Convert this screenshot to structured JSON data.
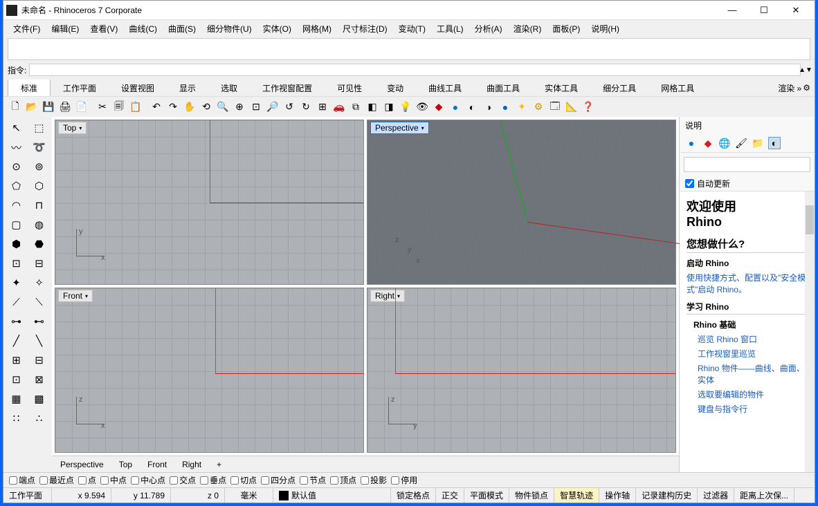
{
  "title": "未命名 - Rhinoceros 7 Corporate",
  "menus": [
    "文件(F)",
    "编辑(E)",
    "查看(V)",
    "曲线(C)",
    "曲面(S)",
    "细分物件(U)",
    "实体(O)",
    "网格(M)",
    "尺寸标注(D)",
    "变动(T)",
    "工具(L)",
    "分析(A)",
    "渲染(R)",
    "面板(P)",
    "说明(H)"
  ],
  "cmd_label": "指令:",
  "tabs": [
    "标准",
    "工作平面",
    "设置视图",
    "显示",
    "选取",
    "工作视窗配置",
    "可见性",
    "变动",
    "曲线工具",
    "曲面工具",
    "实体工具",
    "细分工具",
    "网格工具"
  ],
  "tabs_tail": "渲染 »",
  "active_tab": 0,
  "viewports": {
    "top": "Top",
    "perspective": "Perspective",
    "front": "Front",
    "right": "Right"
  },
  "active_viewport": "Perspective",
  "viewtabs": [
    "Perspective",
    "Top",
    "Front",
    "Right",
    "+"
  ],
  "help": {
    "title": "说明",
    "auto_update": "自动更新",
    "welcome1": "欢迎使用",
    "welcome2": "Rhino",
    "q": "您想做什么?",
    "sec1_title": "启动 Rhino",
    "sec1_desc": "使用快捷方式、配置以及\"安全模式\"启动 Rhino。",
    "sec2_title": "学习 Rhino",
    "sec2_sub": "Rhino 基础",
    "links": [
      "巡览 Rhino 窗口",
      "工作视窗里巡览",
      "Rhino 物件——曲线、曲面、实体",
      "选取要编辑的物件",
      "键盘与指令行"
    ]
  },
  "osnaps": [
    "端点",
    "最近点",
    "点",
    "中点",
    "中心点",
    "交点",
    "垂点",
    "切点",
    "四分点",
    "节点",
    "顶点",
    "投影",
    "停用"
  ],
  "status": {
    "cplane": "工作平面",
    "x": "x 9.594",
    "y": "y 11.789",
    "z": "z 0",
    "unit": "毫米",
    "layer": "默认值",
    "items": [
      "锁定格点",
      "正交",
      "平面模式",
      "物件锁点",
      "智慧轨迹",
      "操作轴",
      "记录建构历史",
      "过滤器",
      "距离上次保..."
    ]
  }
}
